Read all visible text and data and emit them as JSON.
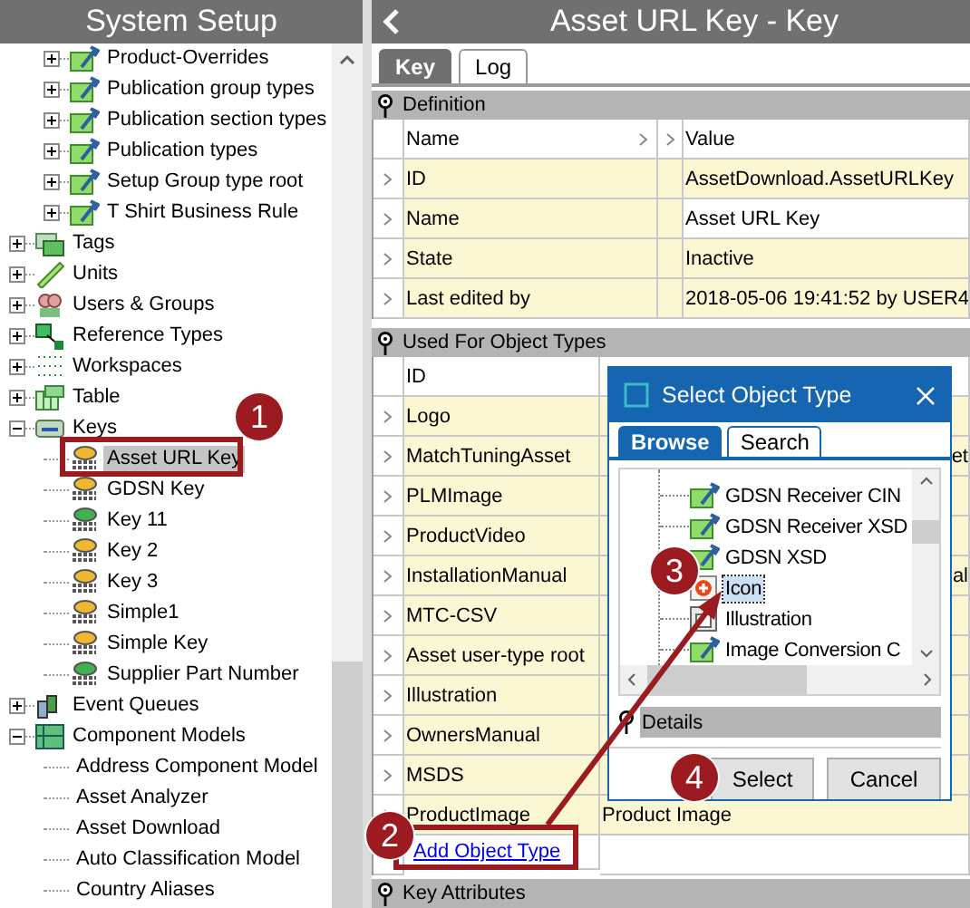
{
  "sidebar": {
    "title": "System Setup",
    "items": [
      {
        "kind": "hidden-parent",
        "children": [
          {
            "label": "Product-Overrides",
            "kind": "setup",
            "expanded": false,
            "selected": false
          },
          {
            "label": "Publication group types",
            "kind": "setup",
            "expanded": false,
            "selected": false
          },
          {
            "label": "Publication section types",
            "kind": "setup",
            "expanded": false,
            "selected": false
          },
          {
            "label": "Publication types",
            "kind": "setup",
            "expanded": false,
            "selected": false
          },
          {
            "label": "Setup Group type root",
            "kind": "setup",
            "expanded": false,
            "selected": false
          },
          {
            "label": "T Shirt Business Rule",
            "kind": "setup",
            "expanded": false,
            "selected": false
          }
        ]
      },
      {
        "label": "Tags",
        "kind": "tags",
        "expanded": false,
        "selected": false
      },
      {
        "label": "Units",
        "kind": "units",
        "expanded": false,
        "selected": false
      },
      {
        "label": "Users & Groups",
        "kind": "users",
        "expanded": false,
        "selected": false
      },
      {
        "label": "Reference Types",
        "kind": "reference",
        "expanded": false,
        "selected": false
      },
      {
        "label": "Workspaces",
        "kind": "workspaces",
        "expanded": false,
        "selected": false
      },
      {
        "label": "Table",
        "kind": "table",
        "expanded": false,
        "selected": false
      },
      {
        "label": "Keys",
        "kind": "keys",
        "expanded": true,
        "selected": false,
        "children": [
          {
            "label": "Asset URL Key",
            "kind": "key-gold",
            "selected": true
          },
          {
            "label": "GDSN Key",
            "kind": "key-gold",
            "selected": false
          },
          {
            "label": "Key 11",
            "kind": "key-green",
            "selected": false
          },
          {
            "label": "Key 2",
            "kind": "key-gold",
            "selected": false
          },
          {
            "label": "Key 3",
            "kind": "key-gold",
            "selected": false
          },
          {
            "label": "Simple1",
            "kind": "key-gold",
            "selected": false
          },
          {
            "label": "Simple Key",
            "kind": "key-gold",
            "selected": false
          },
          {
            "label": "Supplier Part Number",
            "kind": "key-green",
            "selected": false
          }
        ]
      },
      {
        "label": "Event Queues",
        "kind": "queues",
        "expanded": false,
        "selected": false
      },
      {
        "label": "Component Models",
        "kind": "components",
        "expanded": true,
        "selected": false,
        "children": [
          {
            "label": "Address Component Model",
            "kind": "component",
            "selected": false
          },
          {
            "label": "Asset Analyzer",
            "kind": "component",
            "selected": false
          },
          {
            "label": "Asset Download",
            "kind": "component",
            "selected": false
          },
          {
            "label": "Auto Classification Model",
            "kind": "component",
            "selected": false
          },
          {
            "label": "Country Aliases",
            "kind": "component",
            "selected": false
          }
        ]
      }
    ]
  },
  "main": {
    "title": "Asset URL Key - Key",
    "tabs": [
      {
        "label": "Key",
        "selected": true
      },
      {
        "label": "Log",
        "selected": false
      }
    ],
    "definition": {
      "title": "Definition",
      "columns": [
        "Name",
        "Value"
      ],
      "rows": [
        {
          "name": "ID",
          "value": "AssetDownload.AssetURLKey",
          "editable": false
        },
        {
          "name": "Name",
          "value": "Asset URL Key",
          "editable": true
        },
        {
          "name": "State",
          "value": "Inactive",
          "editable": false
        },
        {
          "name": "Last edited by",
          "value": "2018-05-06 19:41:52 by USER4",
          "editable": false
        }
      ]
    },
    "object_types": {
      "title": "Used For Object Types",
      "columns": [
        "ID"
      ],
      "rows": [
        {
          "id": "Logo"
        },
        {
          "id": "MatchTuningAsset",
          "column_2_end": "et"
        },
        {
          "id": "PLMImage"
        },
        {
          "id": "ProductVideo"
        },
        {
          "id": "InstallationManual",
          "column_2_end": "al"
        },
        {
          "id": "MTC-CSV"
        },
        {
          "id": "Asset user-type root"
        },
        {
          "id": "Illustration"
        },
        {
          "id": "OwnersManual"
        },
        {
          "id": "MSDS"
        },
        {
          "id": "ProductImage",
          "column_2": "Product Image"
        }
      ],
      "link": "Add Object Type"
    },
    "key_attributes": {
      "title": "Key Attributes"
    }
  },
  "dialog": {
    "title": "Select Object Type",
    "tabs": [
      {
        "label": "Browse",
        "selected": true
      },
      {
        "label": "Search",
        "selected": false
      }
    ],
    "items": [
      {
        "label": "GDSN Receiver CIN",
        "kind": "setup",
        "selected": false
      },
      {
        "label": "GDSN Receiver XSD",
        "kind": "setup",
        "selected": false
      },
      {
        "label": "GDSN XSD",
        "kind": "setup",
        "selected": false
      },
      {
        "label": "Icon",
        "kind": "image-plus",
        "selected": true
      },
      {
        "label": "Illustration",
        "kind": "image",
        "selected": false
      },
      {
        "label": "Image Conversion C",
        "kind": "setup",
        "selected": false
      }
    ],
    "details": "Details",
    "buttons": [
      "Select",
      "Cancel"
    ]
  },
  "callouts": [
    "1",
    "2",
    "3",
    "4"
  ]
}
